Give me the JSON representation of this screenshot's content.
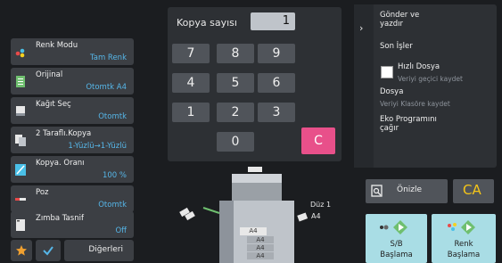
{
  "left_menu": {
    "items": [
      {
        "label": "Renk Modu",
        "value": "Tam Renk"
      },
      {
        "label": "Orijinal",
        "value": "Otomtk A4"
      },
      {
        "label": "Kağıt Seç",
        "value": "Otomtk"
      },
      {
        "label": "2 Taraflı.Kopya",
        "value": "1-Yüzlü→1-Yüzlü"
      },
      {
        "label": "Kopya. Oranı",
        "value": "100 %"
      },
      {
        "label": "Poz",
        "value": "Otomtk"
      },
      {
        "label": "Zımba Tasnif",
        "value": "Off"
      }
    ],
    "others_label": "Diğerleri"
  },
  "copies": {
    "label": "Kopya sayısı",
    "value": "1"
  },
  "keypad": {
    "keys": [
      "7",
      "8",
      "9",
      "4",
      "5",
      "6",
      "1",
      "2",
      "3",
      "0"
    ],
    "clear_label": "C"
  },
  "diagram": {
    "duplex_label": "Düz 1",
    "paper_label": "A4",
    "trays": [
      "A4",
      "A4",
      "A4",
      "A4"
    ]
  },
  "right_panel": {
    "send_print": "Gönder ve yazdır",
    "recent_jobs": "Son İşler",
    "quick_file": "Hızlı Dosya",
    "quick_file_sub": "Veriyi geçici kaydet",
    "file": "Dosya",
    "file_sub": "Veriyi Klasöre kaydet",
    "call_program": "Eko Programını çağır",
    "preview": "Önizle",
    "ca": "CA",
    "bw_start": "S/B Başlama",
    "color_start": "Renk Başlama"
  },
  "colors": {
    "accent_blue": "#56b6e8",
    "clear_pink": "#e8508a",
    "ca_yellow": "#f5c518",
    "start_teal": "#a9dde5",
    "start_pink": "#f5b6cf"
  }
}
